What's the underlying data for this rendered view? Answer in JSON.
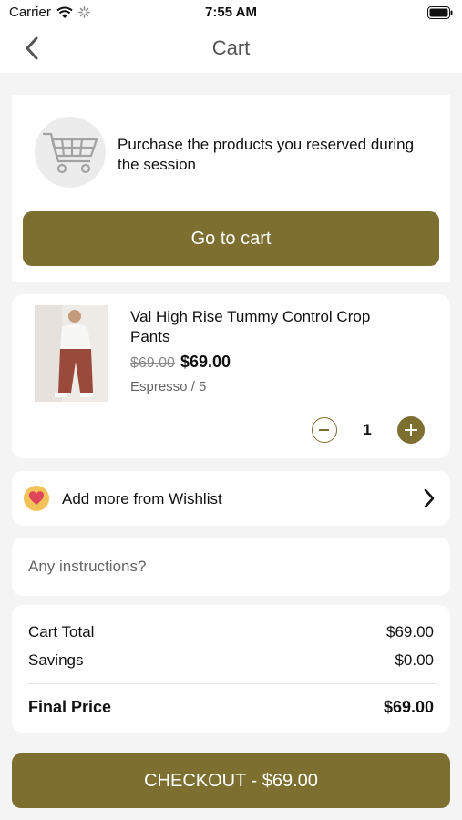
{
  "status_bar": {
    "carrier": "Carrier",
    "time": "7:55 AM"
  },
  "nav": {
    "title": "Cart"
  },
  "reserve": {
    "message": "Purchase the products you reserved during the session",
    "button_label": "Go to cart"
  },
  "product": {
    "name": "Val High Rise Tummy Control Crop Pants",
    "original_price": "$69.00",
    "price": "$69.00",
    "variant": "Espresso / 5",
    "quantity": "1"
  },
  "wishlist": {
    "label": "Add more from Wishlist"
  },
  "instructions": {
    "placeholder": "Any instructions?"
  },
  "totals": {
    "cart_total_label": "Cart Total",
    "cart_total_value": "$69.00",
    "savings_label": "Savings",
    "savings_value": "$0.00",
    "final_label": "Final Price",
    "final_value": "$69.00"
  },
  "checkout": {
    "label": "CHECKOUT - $69.00"
  },
  "colors": {
    "accent": "#7d6f30",
    "background": "#f4f4f4",
    "heart_badge": "#f2c25a",
    "heart": "#e0465a"
  }
}
